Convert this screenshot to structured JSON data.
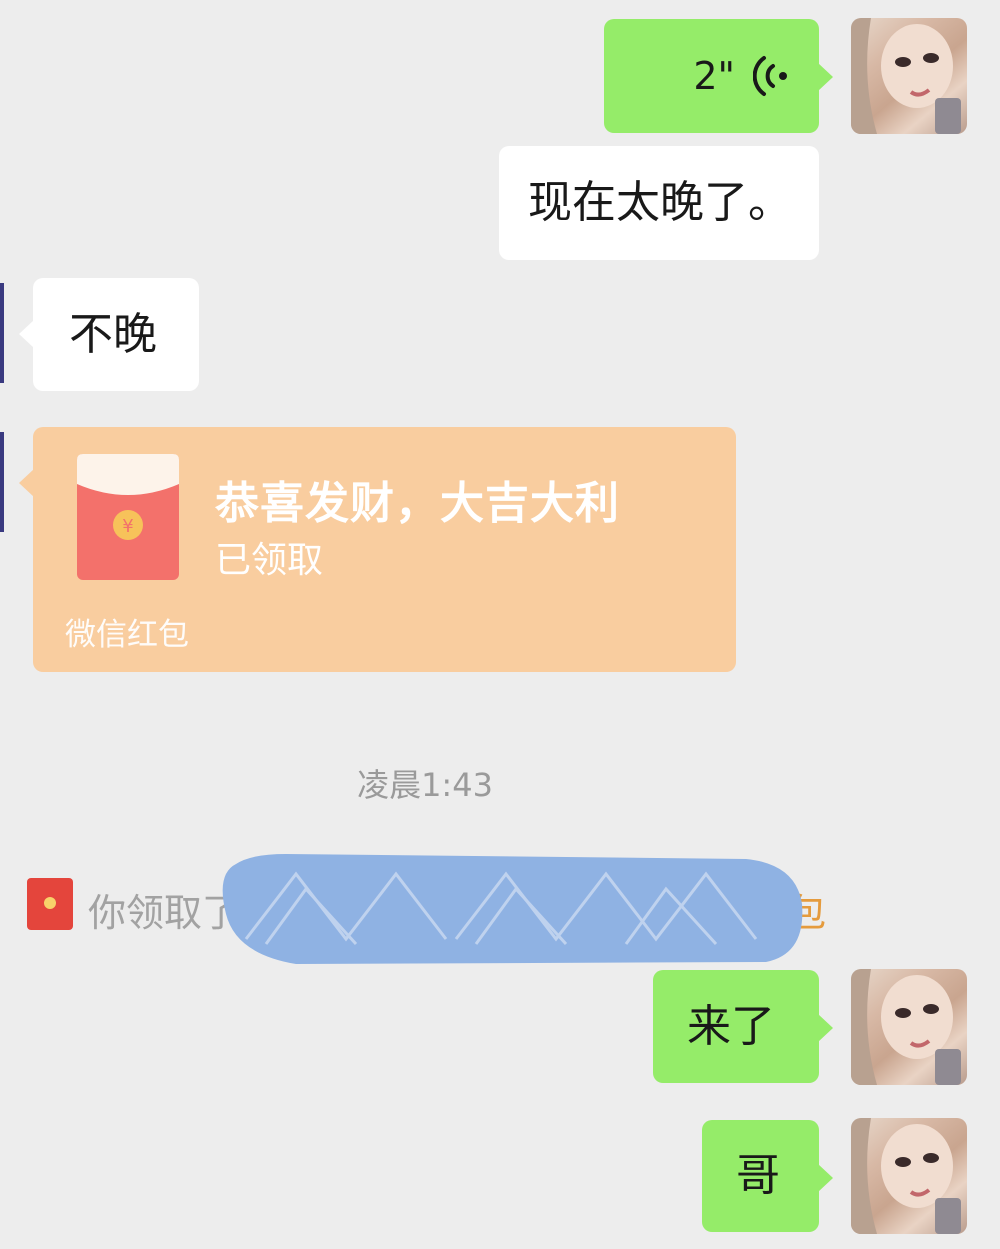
{
  "messages": {
    "voice": {
      "duration": "2\""
    },
    "msg_too_late": "现在太晚了。",
    "msg_not_late": "不晚",
    "msg_coming": "来了",
    "msg_bro": "哥"
  },
  "red_packet": {
    "title": "恭喜发财，大吉大利",
    "status": "已领取",
    "footer": "微信红包"
  },
  "timestamp": "凌晨1:43",
  "system_notice": {
    "text_prefix": "你领取了",
    "text_suffix": "包"
  },
  "colors": {
    "background": "#ededed",
    "sent_bubble": "#95ec69",
    "received_bubble": "#ffffff",
    "red_packet": "#f9cd9f",
    "redaction": "#8fb2e3"
  },
  "icons": {
    "voice": "voice-wave-icon",
    "red_packet": "red-packet-icon",
    "system": "red-envelope-small-icon"
  }
}
